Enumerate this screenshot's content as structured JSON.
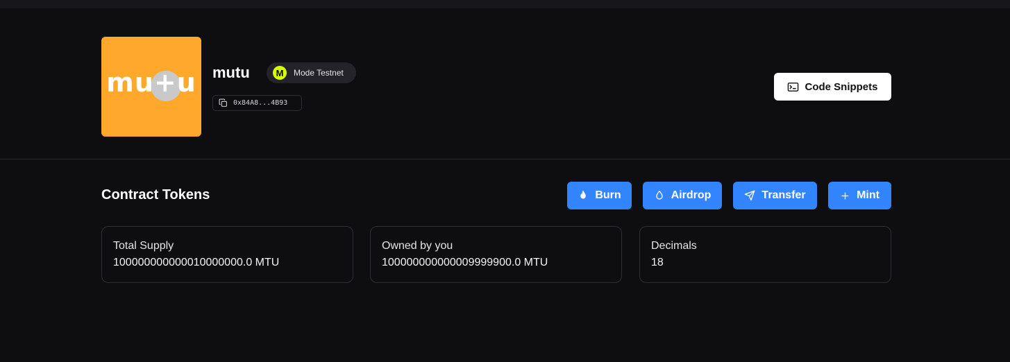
{
  "token": {
    "logo_text": "mu+u",
    "name": "mutu",
    "chain": {
      "badge_letter": "M",
      "name": "Mode Testnet",
      "badge_color": "#d8ff00"
    },
    "address": "0x84A8...4B93",
    "logo_color": "#ffa82c"
  },
  "header": {
    "code_snippets_label": "Code Snippets"
  },
  "section": {
    "title": "Contract Tokens"
  },
  "actions": [
    {
      "label": "Burn",
      "icon": "flame-icon"
    },
    {
      "label": "Airdrop",
      "icon": "droplet-icon"
    },
    {
      "label": "Transfer",
      "icon": "send-icon"
    },
    {
      "label": "Mint",
      "icon": "plus-icon"
    }
  ],
  "stats": [
    {
      "label": "Total Supply",
      "value": "100000000000010000000.0 MTU"
    },
    {
      "label": "Owned by you",
      "value": "100000000000009999900.0 MTU"
    },
    {
      "label": "Decimals",
      "value": "18"
    }
  ],
  "colors": {
    "background": "#0e0e11",
    "accent": "#3385ff",
    "card_border": "#2e2e34"
  }
}
